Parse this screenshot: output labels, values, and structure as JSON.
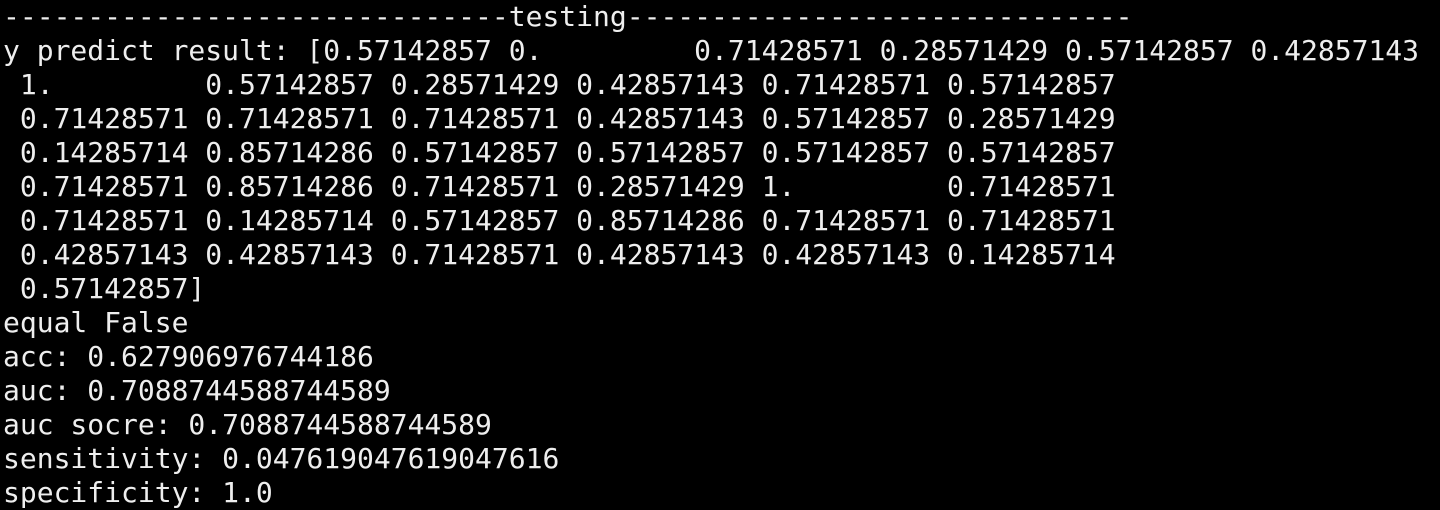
{
  "terminal": {
    "lines": [
      "------------------------------testing------------------------------",
      "y predict result: [0.57142857 0.         0.71428571 0.28571429 0.57142857 0.42857143",
      " 1.         0.57142857 0.28571429 0.42857143 0.71428571 0.57142857",
      " 0.71428571 0.71428571 0.71428571 0.42857143 0.57142857 0.28571429",
      " 0.14285714 0.85714286 0.57142857 0.57142857 0.57142857 0.57142857",
      " 0.71428571 0.85714286 0.71428571 0.28571429 1.         0.71428571",
      " 0.71428571 0.14285714 0.57142857 0.85714286 0.71428571 0.71428571",
      " 0.42857143 0.42857143 0.71428571 0.42857143 0.42857143 0.14285714",
      " 0.57142857]",
      "equal False",
      "acc: 0.627906976744186",
      "auc: 0.7088744588744589",
      "auc socre: 0.7088744588744589",
      "sensitivity: 0.047619047619047616",
      "specificity: 1.0"
    ]
  }
}
